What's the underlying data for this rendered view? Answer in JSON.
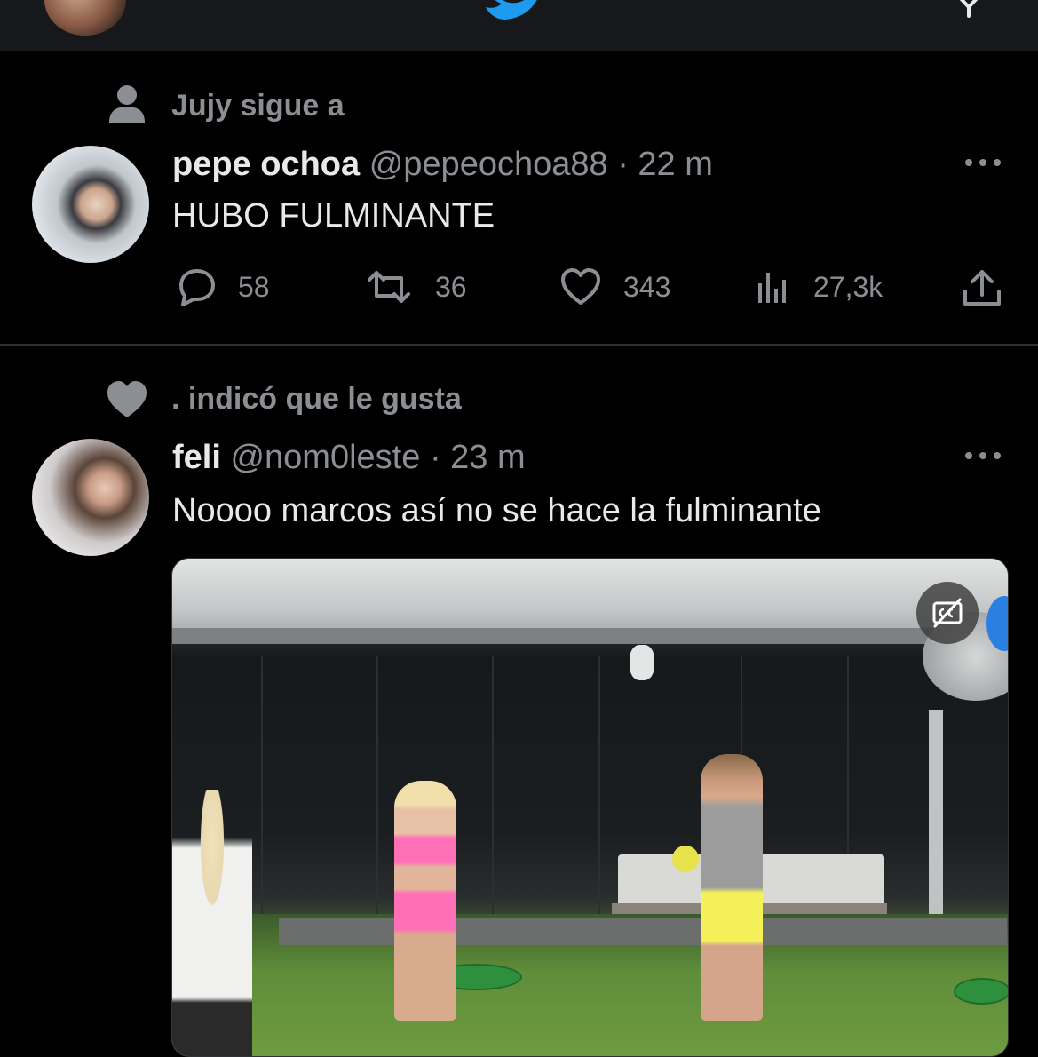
{
  "colors": {
    "background": "#000000",
    "topbar": "#16181c",
    "text_primary": "#e7e9ea",
    "text_secondary": "#8b8f94",
    "twitter_blue": "#1d9bf0",
    "divider": "#2f3336"
  },
  "topbar": {
    "logo_icon": "twitter-bird-icon",
    "right_icon": "filter-icon"
  },
  "tweets": [
    {
      "context_icon": "person-icon",
      "context_text": "Jujy sigue a",
      "display_name": "pepe ochoa",
      "handle": "@pepeochoa88",
      "separator": "·",
      "time": "22 m",
      "text": "HUBO FULMINANTE",
      "actions": {
        "replies": "58",
        "retweets": "36",
        "likes": "343",
        "views": "27,3k"
      }
    },
    {
      "context_icon": "heart-icon",
      "context_text": ". indicó que le gusta",
      "display_name": "feli",
      "handle": "@nom0leste",
      "separator": "·",
      "time": "23 m",
      "text": "Noooo marcos así no se hace la fulminante",
      "media": {
        "type": "video",
        "captions_icon": "captions-off-icon"
      }
    }
  ]
}
